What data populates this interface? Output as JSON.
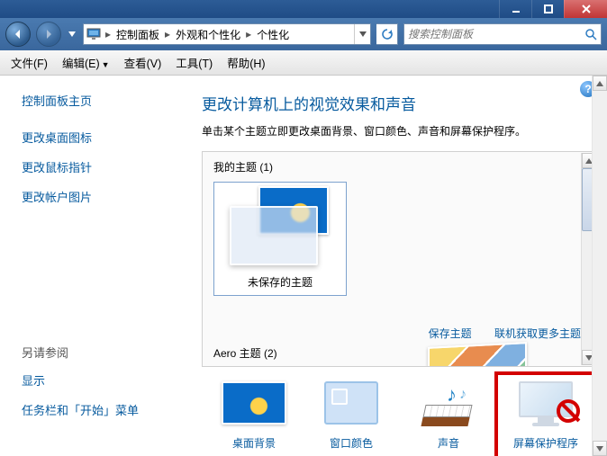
{
  "breadcrumb": {
    "items": [
      "控制面板",
      "外观和个性化",
      "个性化"
    ]
  },
  "search": {
    "placeholder": "搜索控制面板"
  },
  "menu": {
    "file": "文件(F)",
    "edit": "编辑(E)",
    "view": "查看(V)",
    "tools": "工具(T)",
    "help": "帮助(H)"
  },
  "sidebar": {
    "links": [
      "控制面板主页",
      "更改桌面图标",
      "更改鼠标指针",
      "更改帐户图片"
    ],
    "see_also_title": "另请参阅",
    "see_also": [
      "显示",
      "任务栏和「开始」菜单"
    ]
  },
  "page": {
    "title": "更改计算机上的视觉效果和声音",
    "subtitle": "单击某个主题立即更改桌面背景、窗口颜色、声音和屏幕保护程序。",
    "help_label": "?"
  },
  "themes": {
    "my_themes_label": "我的主题 (1)",
    "unsaved_label": "未保存的主题",
    "save_link": "保存主题",
    "get_more_link": "联机获取更多主题",
    "aero_label": "Aero 主题 (2)"
  },
  "bottom": {
    "background": "桌面背景",
    "color": "窗口颜色",
    "sound": "声音",
    "screensaver": "屏幕保护程序"
  }
}
